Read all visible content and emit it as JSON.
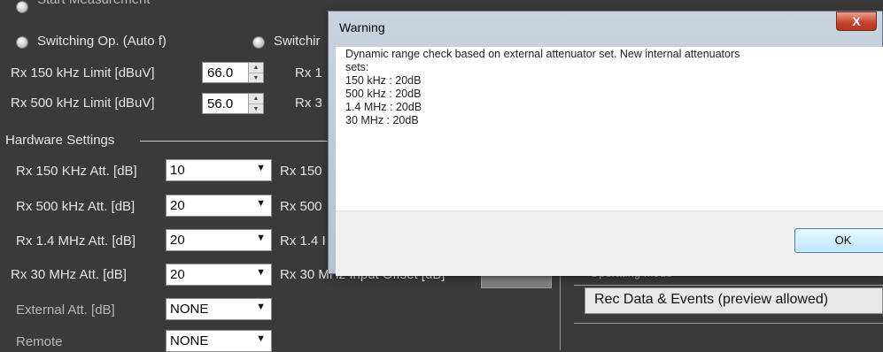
{
  "background_panel": {
    "meas_options": {
      "top_cut_label": "Start Measurement",
      "switching_auto_label": "Switching Op. (Auto f)",
      "switching_other_label": "Switchir",
      "rx150_limit_label": "Rx 150 kHz Limit [dBuV]",
      "rx150_limit_value": "66.0",
      "rx500_limit_label": "Rx 500 kHz Limit [dBuV]",
      "rx500_limit_value": "56.0",
      "right_col_label_1": "Rx 1",
      "right_col_label_2": "Rx 3"
    },
    "hardware": {
      "group_title": "Hardware Settings",
      "rows": [
        {
          "label": "Rx 150 KHz Att. [dB]",
          "value": "10",
          "offset_label": "Rx 150"
        },
        {
          "label": "Rx 500 kHz Att. [dB]",
          "value": "20",
          "offset_label": "Rx 500"
        },
        {
          "label": "Rx 1.4 MHz Att. [dB]",
          "value": "20",
          "offset_label": "Rx 1.4 I"
        },
        {
          "label": "Rx 30 MHz Att. [dB]",
          "value": "20",
          "offset_label": "Rx 30 MHz Input Offset [dB]"
        }
      ],
      "external_att_label": "External Att. [dB]",
      "external_att_value": "NONE",
      "remote_label": "Remote",
      "remote_value": "NONE"
    },
    "right_panel": {
      "header_cut": "Operating Mode",
      "mode_value": "Rec Data & Events (preview allowed)"
    }
  },
  "dialog": {
    "title": "Warning",
    "close_label": "X",
    "message_lines": [
      "Dynamic range check based on external attenuator set. New internal attenuators",
      "sets:",
      "150 kHz : 20dB",
      "500 kHz : 20dB",
      "1.4 MHz : 20dB",
      "30 MHz : 20dB"
    ],
    "ok_label": "OK"
  },
  "colors": {
    "panel_background": "#3a3a3a",
    "dialog_frame": "#c8d3df",
    "close_button": "#c7452f",
    "ok_button": "#bee6fd"
  }
}
